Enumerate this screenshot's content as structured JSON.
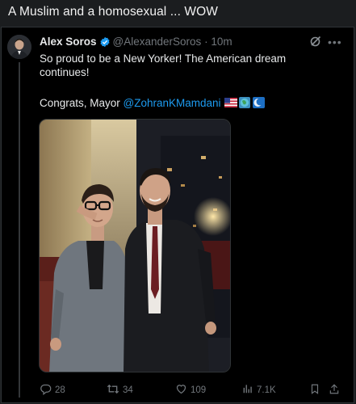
{
  "caption": "A Muslim and a homosexual ... WOW",
  "tweet": {
    "display_name": "Alex Soros",
    "handle": "@AlexanderSoros",
    "separator": "·",
    "time": "10m",
    "text": "So proud to be a New Yorker! The American dream continues!",
    "line2_prefix": "Congrats, Mayor ",
    "mention": "@ZohranKMamdani",
    "emoji_icons": [
      "us-flag-icon",
      "earth-globe-icon",
      "crescent-moon-icon"
    ]
  },
  "actions": {
    "replies": "28",
    "reposts": "34",
    "likes": "109",
    "views": "7.1K"
  },
  "colors": {
    "background": "#000000",
    "accent": "#1d9bf0",
    "muted": "#71767b",
    "text": "#e7e9ea"
  }
}
